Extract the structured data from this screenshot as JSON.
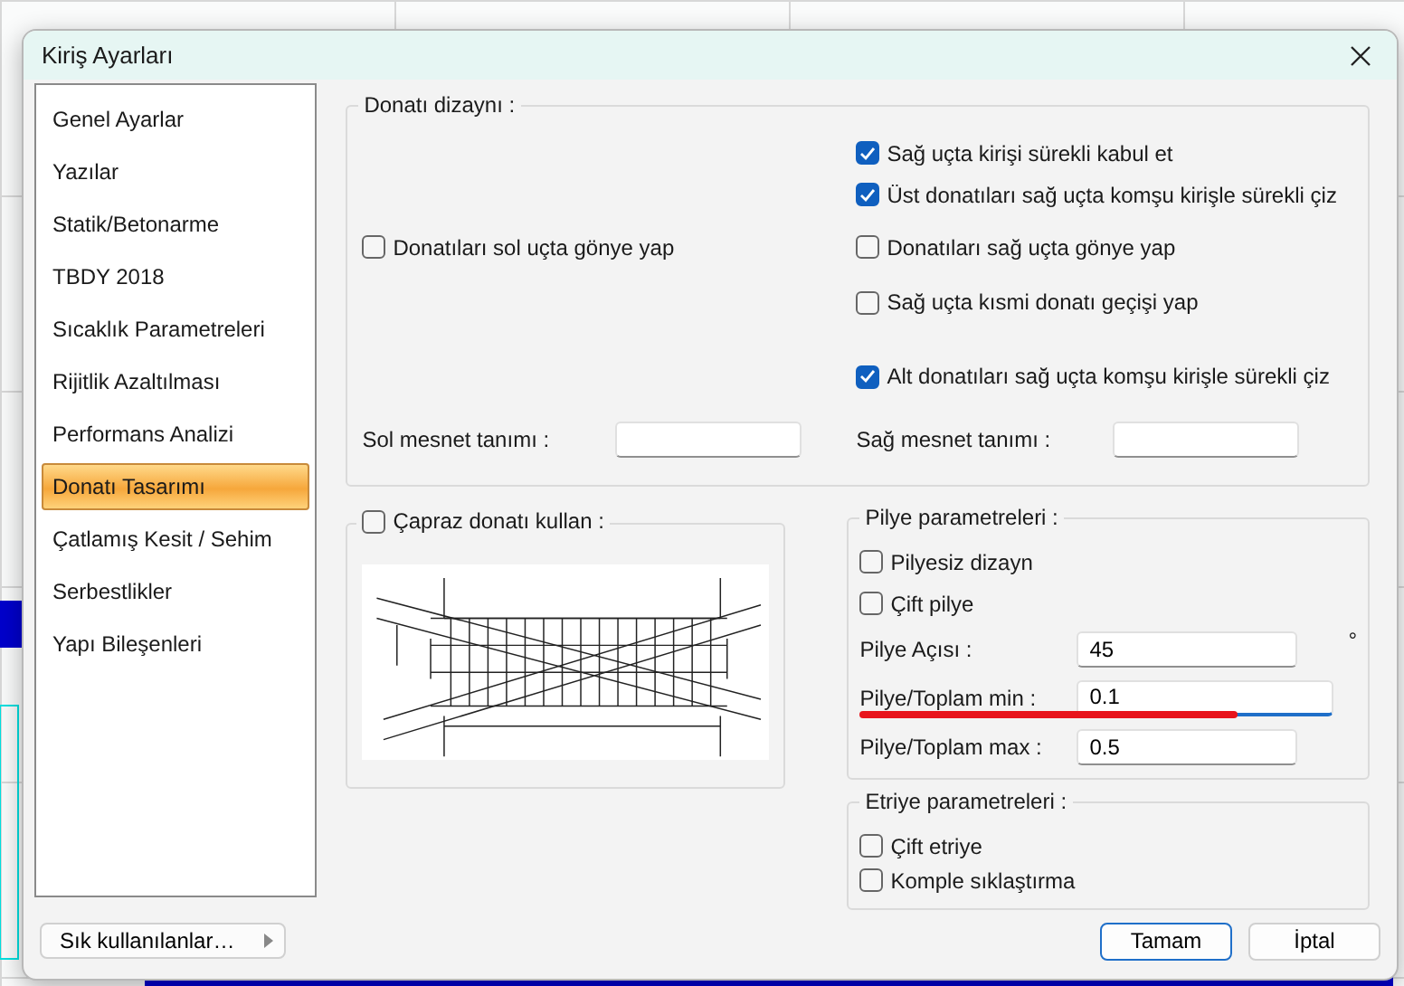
{
  "window": {
    "title": "Kiriş Ayarları"
  },
  "sidebar": {
    "items": [
      {
        "label": "Genel Ayarlar",
        "selected": false
      },
      {
        "label": "Yazılar",
        "selected": false
      },
      {
        "label": "Statik/Betonarme",
        "selected": false
      },
      {
        "label": "TBDY 2018",
        "selected": false
      },
      {
        "label": "Sıcaklık Parametreleri",
        "selected": false
      },
      {
        "label": "Rijitlik Azaltılması",
        "selected": false
      },
      {
        "label": "Performans Analizi",
        "selected": false
      },
      {
        "label": "Donatı Tasarımı",
        "selected": true
      },
      {
        "label": "Çatlamış Kesit / Sehim",
        "selected": false
      },
      {
        "label": "Serbestlikler",
        "selected": false
      },
      {
        "label": "Yapı Bileşenleri",
        "selected": false
      }
    ]
  },
  "donati_dizayni": {
    "title": "Donatı dizaynı :",
    "left_options": [
      {
        "label": "Donatıları sol uçta gönye yap",
        "checked": false
      }
    ],
    "right_options": [
      {
        "label": "Sağ uçta kirişi sürekli kabul et",
        "checked": true
      },
      {
        "label": "Üst donatıları sağ uçta komşu kirişle sürekli çiz",
        "checked": true
      },
      {
        "label": "Donatıları sağ uçta gönye yap",
        "checked": false
      },
      {
        "label": "Sağ uçta kısmi donatı geçişi yap",
        "checked": false
      },
      {
        "label": "Alt donatıları sağ uçta komşu kirişle sürekli çiz",
        "checked": true
      }
    ],
    "fields": [
      {
        "label": "Sol mesnet tanımı :"
      },
      {
        "label": "Sağ mesnet tanımı :"
      }
    ]
  },
  "capraz": {
    "label": "Çapraz donatı kullan :",
    "checked": false
  },
  "pilye": {
    "title": "Pilye parametreleri :",
    "options": [
      {
        "label": "Pilyesiz dizayn",
        "checked": false
      },
      {
        "label": "Çift pilye",
        "checked": false
      }
    ],
    "fields": [
      {
        "label": "Pilye Açısı :",
        "value": "45",
        "unit": "°",
        "focused": false
      },
      {
        "label": "Pilye/Toplam min :",
        "value": "0.1",
        "focused": true,
        "underlined": true
      },
      {
        "label": "Pilye/Toplam max :",
        "value": "0.5",
        "focused": false
      }
    ]
  },
  "etriye": {
    "title": "Etriye parametreleri :",
    "options": [
      {
        "label": "Çift etriye",
        "checked": false
      },
      {
        "label": "Komple sıklaştırma",
        "checked": false
      }
    ]
  },
  "favorites_button": {
    "label": "Sık kullanılanlar…"
  },
  "buttons": [
    {
      "label": "Tamam",
      "kind": "default"
    },
    {
      "label": "İptal",
      "kind": "normal"
    }
  ]
}
